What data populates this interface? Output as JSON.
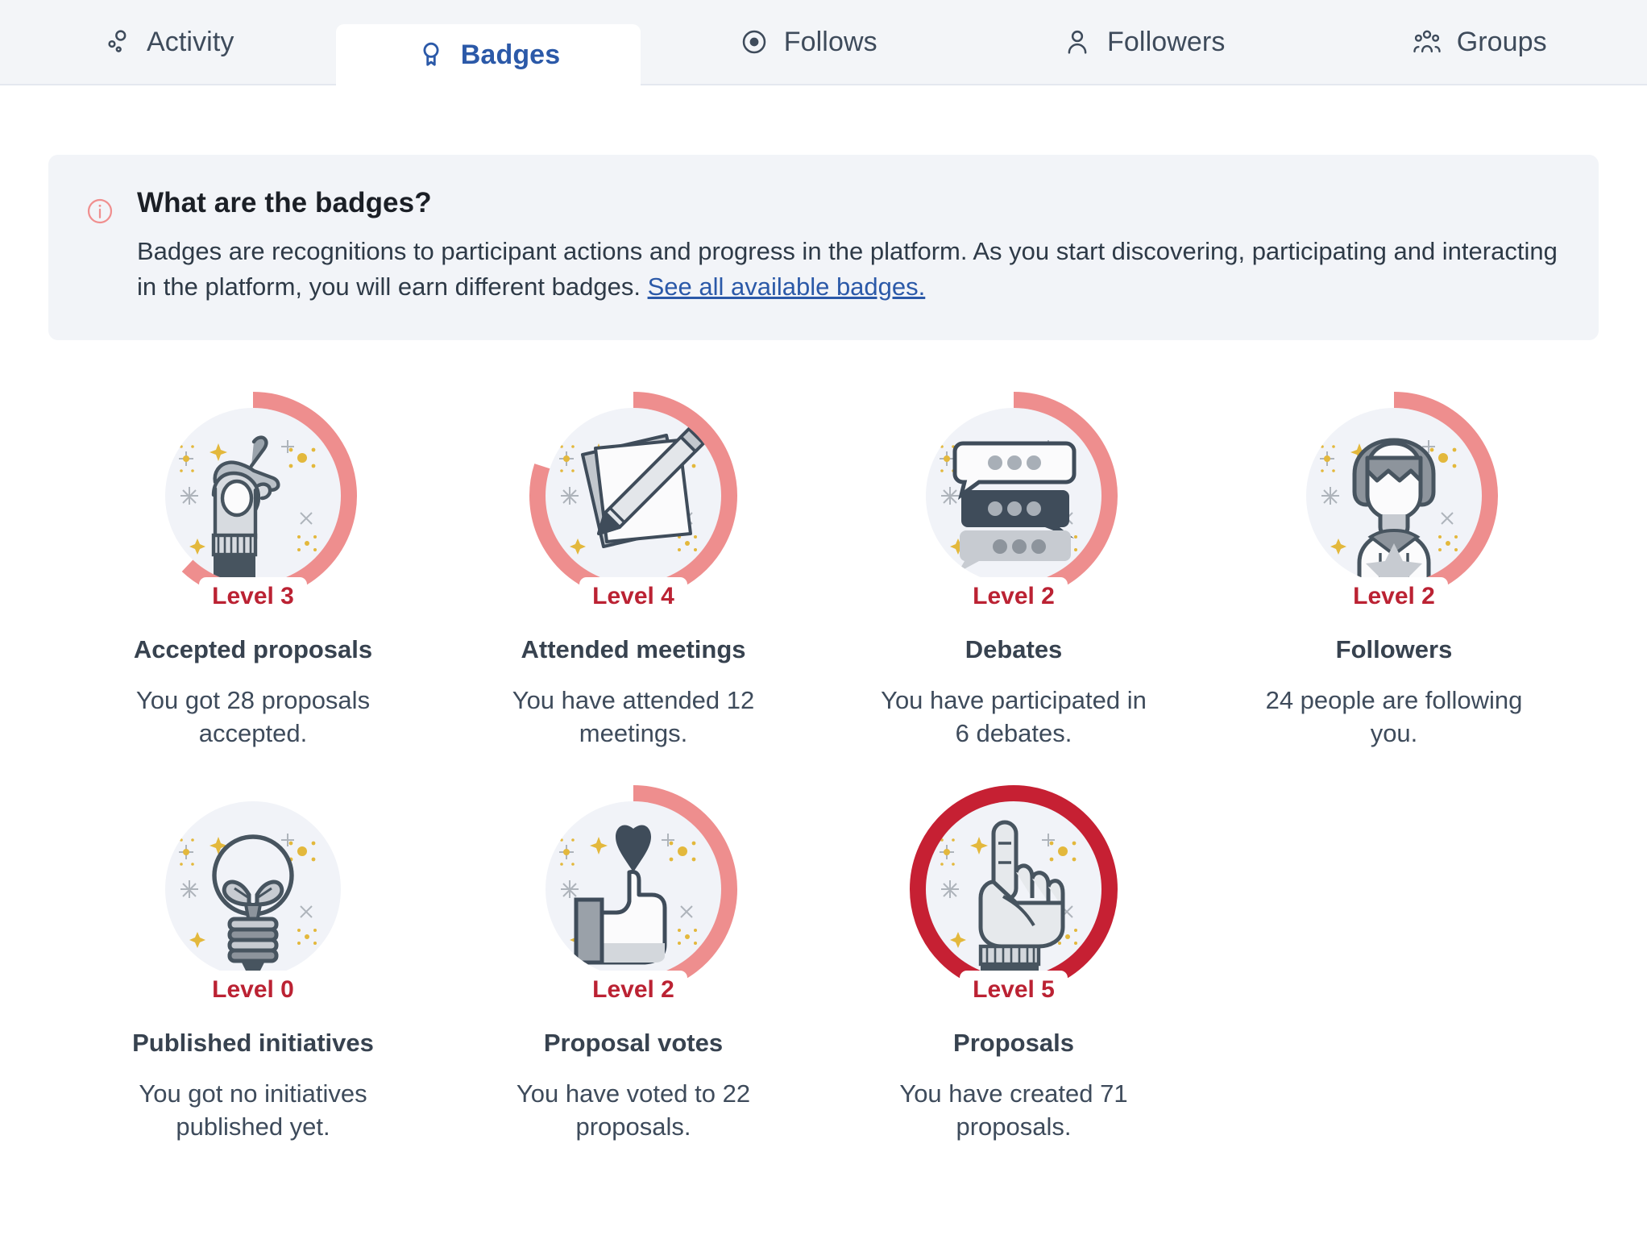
{
  "tabs": [
    {
      "label": "Activity",
      "icon": "activity-icon",
      "active": false
    },
    {
      "label": "Badges",
      "icon": "badge-ribbon-icon",
      "active": true
    },
    {
      "label": "Follows",
      "icon": "eye-icon",
      "active": false
    },
    {
      "label": "Followers",
      "icon": "person-icon",
      "active": false
    },
    {
      "label": "Groups",
      "icon": "people-group-icon",
      "active": false
    }
  ],
  "callout": {
    "icon": "info-circle-icon",
    "title": "What are the badges?",
    "text": "Badges are recognitions to participant actions and progress in the platform. As you start discovering, participating and interacting in the platform, you will earn different badges. ",
    "link_label": "See all available badges."
  },
  "badges": [
    {
      "art": "hand-ok-icon",
      "level_label": "Level 3",
      "level": 3,
      "progress": 0.62,
      "complete": false,
      "name": "Accepted proposals",
      "description": "You got 28 proposals accepted."
    },
    {
      "art": "pencil-papers-icon",
      "level_label": "Level 4",
      "level": 4,
      "progress": 0.8,
      "complete": false,
      "name": "Attended meetings",
      "description": "You have attended 12 meetings."
    },
    {
      "art": "chat-bubbles-icon",
      "level_label": "Level 2",
      "level": 2,
      "progress": 0.45,
      "complete": false,
      "name": "Debates",
      "description": "You have participated in 6 debates."
    },
    {
      "art": "person-star-icon",
      "level_label": "Level 2",
      "level": 2,
      "progress": 0.45,
      "complete": false,
      "name": "Followers",
      "description": "24 people are following you."
    },
    {
      "art": "lightbulb-icon",
      "level_label": "Level 0",
      "level": 0,
      "progress": 0.0,
      "complete": false,
      "name": "Published initiatives",
      "description": "You got no initiatives published yet."
    },
    {
      "art": "thumbs-up-heart-icon",
      "level_label": "Level 2",
      "level": 2,
      "progress": 0.45,
      "complete": false,
      "name": "Proposal votes",
      "description": "You have voted to 22 proposals."
    },
    {
      "art": "hand-point-up-icon",
      "level_label": "Level 5",
      "level": 5,
      "progress": 1.0,
      "complete": true,
      "name": "Proposals",
      "description": "You have created 71 proposals."
    }
  ],
  "colors": {
    "tab_active_text": "#2b59a8",
    "tab_text": "#3e4b5b",
    "tabbar_bg": "#f3f5f8",
    "callout_bg": "#f2f4f8",
    "link": "#2b59a8",
    "level_text": "#bb2233",
    "ring_partial": "#ee8e8e",
    "ring_complete": "#c62033",
    "disc_bg": "#f1f3f8",
    "ink": "#3e4b5b",
    "info_icon": "#f08f8f"
  }
}
